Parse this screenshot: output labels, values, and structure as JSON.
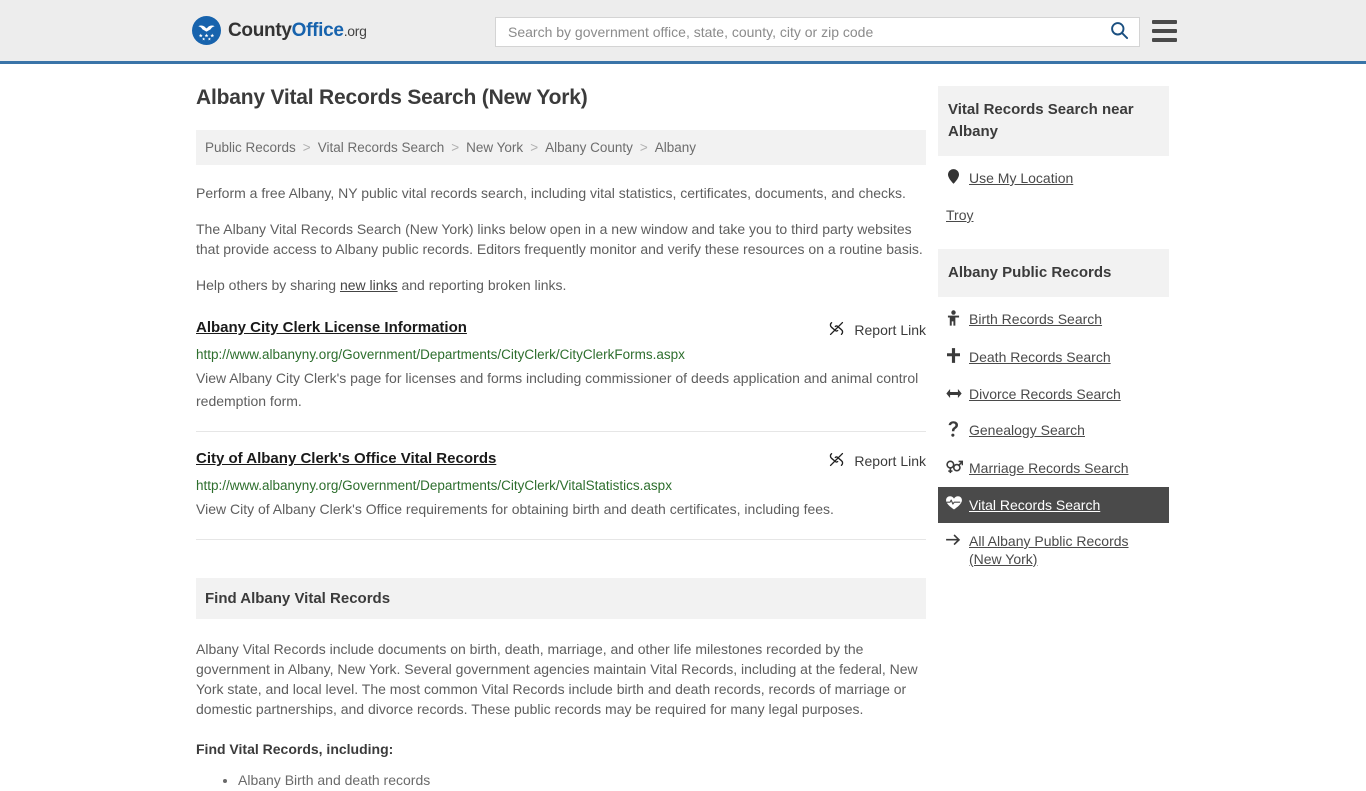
{
  "header": {
    "logo": {
      "part1": "County",
      "part2": "Office",
      "part3": ".org",
      "icon": "eagle-stars-emblem"
    },
    "search": {
      "placeholder": "Search by government office, state, county, city or zip code",
      "value": "",
      "icon": "search-icon"
    },
    "menu_icon": "hamburger-menu-icon",
    "accent_color": "#3a74a8"
  },
  "page": {
    "title": "Albany Vital Records Search (New York)",
    "breadcrumb": [
      "Public Records",
      "Vital Records Search",
      "New York",
      "Albany County",
      "Albany"
    ],
    "breadcrumb_separator": ">",
    "intro": [
      "Perform a free Albany, NY public vital records search, including vital statistics, certificates, documents, and checks.",
      "The Albany Vital Records Search (New York) links below open in a new window and take you to third party websites that provide access to Albany public records. Editors frequently monitor and verify these resources on a routine basis."
    ],
    "help_prefix": "Help others by sharing ",
    "help_link": "new links",
    "help_suffix": " and reporting broken links."
  },
  "results": [
    {
      "title": "Albany City Clerk License Information",
      "url": "http://www.albanyny.org/Government/Departments/CityClerk/CityClerkForms.aspx",
      "description": "View Albany City Clerk's page for licenses and forms including commissioner of deeds application and animal control redemption form.",
      "report_label": "Report Link",
      "report_icon": "broken-link-icon"
    },
    {
      "title": "City of Albany Clerk's Office Vital Records",
      "url": "http://www.albanyny.org/Government/Departments/CityClerk/VitalStatistics.aspx",
      "description": "View City of Albany Clerk's Office requirements for obtaining birth and death certificates, including fees.",
      "report_label": "Report Link",
      "report_icon": "broken-link-icon"
    }
  ],
  "find_section": {
    "heading": "Find Albany Vital Records",
    "body": "Albany Vital Records include documents on birth, death, marriage, and other life milestones recorded by the government in Albany, New York. Several government agencies maintain Vital Records, including at the federal, New York state, and local level. The most common Vital Records include birth and death records, records of marriage or domestic partnerships, and divorce records. These public records may be required for many legal purposes.",
    "sub_heading": "Find Vital Records, including:",
    "items": [
      "Albany Birth and death records"
    ]
  },
  "sidebar": {
    "near_box": {
      "heading": "Vital Records Search near Albany",
      "items": [
        {
          "label": "Use My Location",
          "icon": "map-pin-icon",
          "has_icon": true
        },
        {
          "label": "Troy",
          "icon": "",
          "has_icon": false
        }
      ]
    },
    "records_box": {
      "heading": "Albany Public Records",
      "items": [
        {
          "label": "Birth Records Search",
          "icon": "baby-icon",
          "active": false
        },
        {
          "label": "Death Records Search",
          "icon": "cross-icon",
          "active": false
        },
        {
          "label": "Divorce Records Search",
          "icon": "double-arrow-icon",
          "active": false
        },
        {
          "label": "Genealogy Search",
          "icon": "question-mark-icon",
          "active": false
        },
        {
          "label": "Marriage Records Search",
          "icon": "venus-mars-icon",
          "active": false
        },
        {
          "label": "Vital Records Search",
          "icon": "heartbeat-icon",
          "active": true
        },
        {
          "label": "All Albany Public Records (New York)",
          "icon": "arrow-right-icon",
          "active": false
        }
      ],
      "active_bg": "#4a4a4a"
    }
  }
}
